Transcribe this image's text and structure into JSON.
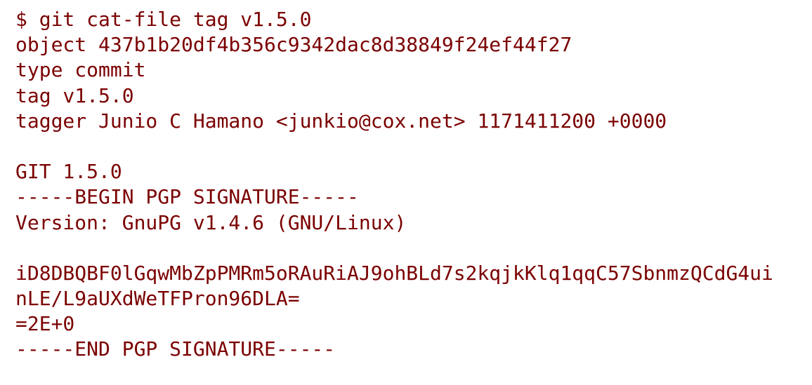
{
  "text_color": "#7b0000",
  "background": "#ffffff",
  "lines": [
    "$ git cat-file tag v1.5.0",
    "object 437b1b20df4b356c9342dac8d38849f24ef44f27",
    "type commit",
    "tag v1.5.0",
    "tagger Junio C Hamano <junkio@cox.net> 1171411200 +0000",
    "",
    "GIT 1.5.0",
    "-----BEGIN PGP SIGNATURE-----",
    "Version: GnuPG v1.4.6 (GNU/Linux)",
    "",
    "iD8DBQBF0lGqwMbZpPMRm5oRAuRiAJ9ohBLd7s2kqjkKlq1qqC57SbnmzQCdG4ui",
    "nLE/L9aUXdWeTFPron96DLA=",
    "=2E+0",
    "-----END PGP SIGNATURE-----"
  ]
}
